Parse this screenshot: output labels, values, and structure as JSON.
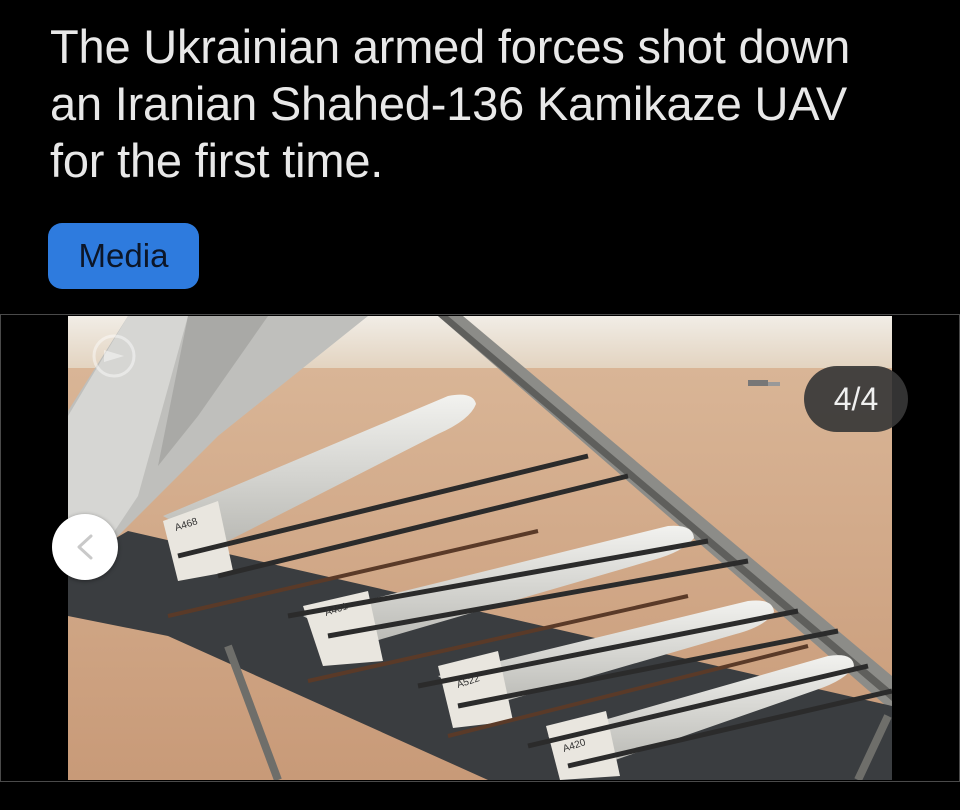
{
  "post": {
    "headline": "The Ukrainian armed forces shot down an Iranian Shahed-136 Kamikaze UAV for the first time.",
    "tag_label": "Media"
  },
  "gallery": {
    "counter": "4/4",
    "prev_icon": "chevron-left-icon",
    "image_alt": "Shahed-136 drones on launch rack in desert",
    "drone_labels": [
      "A468",
      "A401",
      "A522",
      "A420"
    ]
  },
  "colors": {
    "background": "#000000",
    "tag_bg": "#2e7bde",
    "counter_bg": "#373737"
  }
}
